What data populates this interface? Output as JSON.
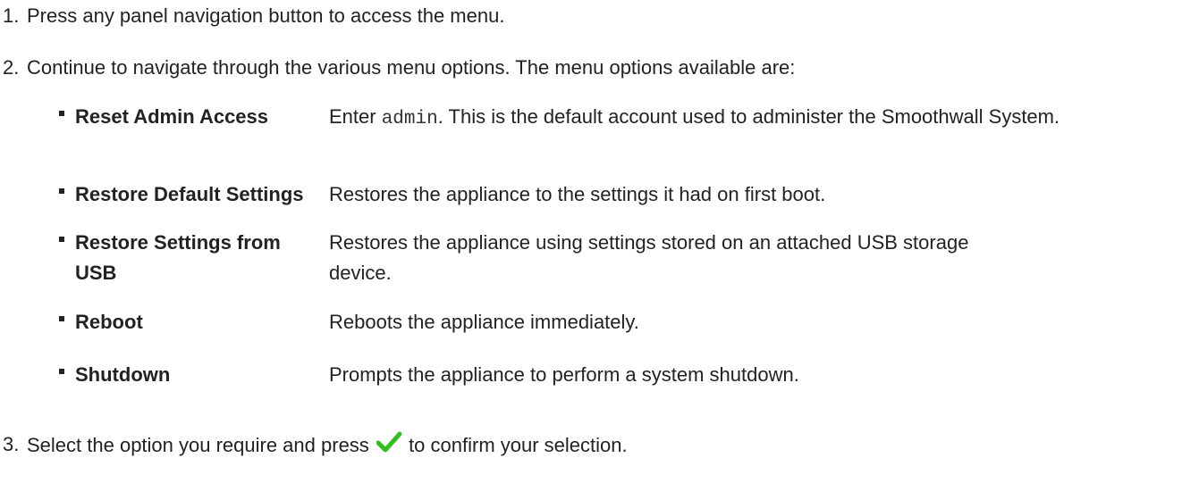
{
  "steps": [
    {
      "num": "1.",
      "text": "Press any panel navigation button to access the menu."
    },
    {
      "num": "2.",
      "text": "Continue to navigate through the various menu options. The menu options available are:"
    },
    {
      "num": "3.",
      "text_before": "Select the option you require and press",
      "text_after": "to confirm your selection."
    }
  ],
  "options": [
    {
      "name": "Reset Admin Access",
      "desc_before": "Enter ",
      "desc_code": "admin",
      "desc_after": ". This is the default account used to administer the Smoothwall System."
    },
    {
      "name": "Restore Default Settings",
      "desc": "Restores the appliance to the settings it had on first boot."
    },
    {
      "name": "Restore Settings from USB",
      "desc": "Restores the appliance using settings stored on an attached USB storage device."
    },
    {
      "name": "Reboot",
      "desc": "Reboots the appliance immediately."
    },
    {
      "name": "Shutdown",
      "desc": "Prompts the appliance to perform a system shutdown."
    }
  ],
  "icons": {
    "confirm": "checkmark-icon",
    "check_color": "#2fbf1f"
  }
}
